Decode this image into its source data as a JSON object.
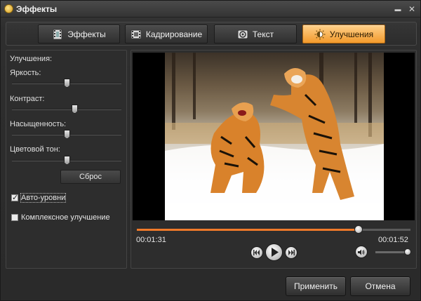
{
  "window": {
    "title": "Эффекты",
    "minimize_glyph": "▬",
    "close_glyph": "✕"
  },
  "tabs": [
    {
      "label": "Эффекты",
      "icon": "film-icon",
      "active": false
    },
    {
      "label": "Кадрирование",
      "icon": "crop-icon",
      "active": false
    },
    {
      "label": "Текст",
      "icon": "text-icon",
      "active": false
    },
    {
      "label": "Улучшения",
      "icon": "sun-icon",
      "active": true
    }
  ],
  "enhancements": {
    "section_title": "Улучшения:",
    "brightness": {
      "label": "Яркость:",
      "value": 0.5
    },
    "contrast": {
      "label": "Контраст:",
      "value": 0.57
    },
    "saturation": {
      "label": "Насыщенность:",
      "value": 0.5
    },
    "hue": {
      "label": "Цветовой тон:",
      "value": 0.5
    },
    "reset_label": "Сброс",
    "auto_levels": {
      "label": "Авто-уровни",
      "checked": true
    },
    "complex": {
      "label": "Комплексное улучшение",
      "checked": false
    }
  },
  "player": {
    "current_time": "00:01:31",
    "total_time": "00:01:52",
    "progress": 0.81,
    "volume": 0.95,
    "accent_color": "#f07a2a"
  },
  "buttons": {
    "apply": "Применить",
    "cancel": "Отмена"
  }
}
